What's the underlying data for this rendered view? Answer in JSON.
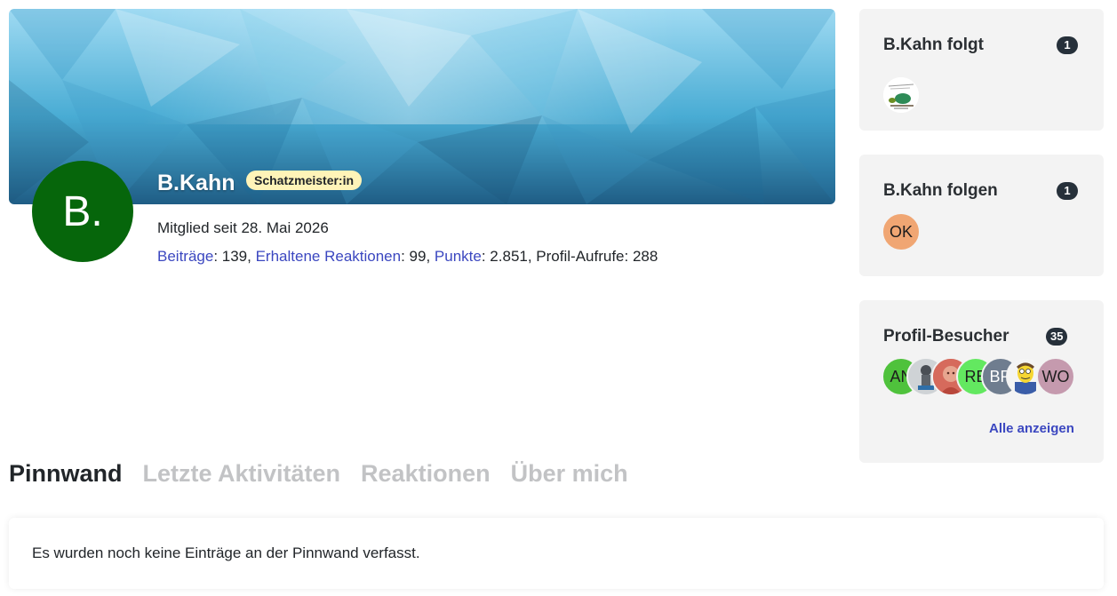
{
  "profile": {
    "avatar_initials": "B.",
    "avatar_color": "#06660b",
    "username": "B.Kahn",
    "rank": "Schatzmeister:in",
    "member_since": "Mitglied seit 28. Mai 2026",
    "stats": {
      "posts_label": "Beiträge",
      "posts_value": ": 139, ",
      "reactions_label": "Erhaltene Reaktionen",
      "reactions_value": ": 99, ",
      "points_label": "Punkte",
      "points_value": ": 2.851, ",
      "views_text": "Profil-Aufrufe: 288"
    }
  },
  "sidebar": {
    "following": {
      "title": "B.Kahn folgt",
      "count": "1",
      "avatars": [
        {
          "type": "image",
          "icon": "cartoon-avatar-icon"
        }
      ]
    },
    "followers": {
      "title": "B.Kahn folgen",
      "count": "1",
      "avatars": [
        {
          "initials": "OK",
          "color": "#f0a673"
        }
      ]
    },
    "visitors": {
      "title": "Profil-Besucher",
      "count": "35",
      "avatars": [
        {
          "initials": "AN",
          "color": "#4fc23c"
        },
        {
          "icon": "chess-avatar-icon"
        },
        {
          "icon": "portrait-avatar-icon"
        },
        {
          "initials": "RE",
          "color": "#63e860"
        },
        {
          "initials": "BR",
          "color": "#6f7d8f"
        },
        {
          "icon": "cartoon-face-avatar-icon"
        },
        {
          "initials": "WO",
          "color": "#c59aae"
        }
      ],
      "show_all": "Alle anzeigen"
    }
  },
  "tabs": [
    {
      "label": "Pinnwand",
      "active": true
    },
    {
      "label": "Letzte Aktivitäten",
      "active": false
    },
    {
      "label": "Reaktionen",
      "active": false
    },
    {
      "label": "Über mich",
      "active": false
    }
  ],
  "wall": {
    "empty_message": "Es wurden noch keine Einträge an der Pinnwand verfasst."
  },
  "colors": {
    "link": "#3b47c0",
    "badge_dark": "#26303a",
    "rank_badge": "#fff4b8"
  }
}
